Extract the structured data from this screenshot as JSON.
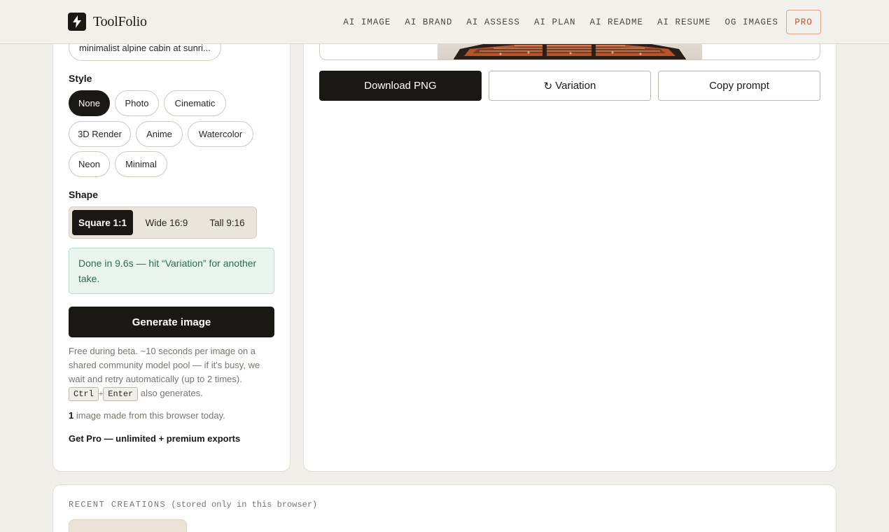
{
  "brand": {
    "name": "ToolFolio",
    "logo_icon": "lightning-bolt-icon"
  },
  "nav": {
    "links": [
      "AI IMAGE",
      "AI BRAND",
      "AI ASSESS",
      "AI PLAN",
      "AI README",
      "AI RESUME",
      "OG IMAGES"
    ],
    "pro_label": "PRO"
  },
  "prompt": {
    "chip_text": "minimalist alpine cabin at sunri..."
  },
  "style": {
    "label": "Style",
    "options": [
      "None",
      "Photo",
      "Cinematic",
      "3D Render",
      "Anime",
      "Watercolor",
      "Neon",
      "Minimal"
    ],
    "selected": "None"
  },
  "shape": {
    "label": "Shape",
    "options": [
      "Square 1:1",
      "Wide 16:9",
      "Tall 9:16"
    ],
    "selected": "Square 1:1"
  },
  "status": {
    "message": "Done in 9.6s — hit “Variation” for another take."
  },
  "generate": {
    "label": "Generate image"
  },
  "help": {
    "text": "Free during beta. ~10 seconds per image on a shared community model pool — if it's busy, we wait and retry automatically (up to 2 times).",
    "key1": "Ctrl",
    "plus": "+",
    "key2": "Enter",
    "suffix": "also generates."
  },
  "usage": {
    "count": "1",
    "text": "image made from this browser today."
  },
  "pro_link": "Get Pro — unlimited + premium exports",
  "actions": {
    "download_label": "Download PNG",
    "variation_icon": "refresh-icon",
    "variation_glyph": "↻",
    "variation_label": "Variation",
    "copy_label": "Copy prompt"
  },
  "recent": {
    "title": "RECENT CREATIONS",
    "note": "(stored only in this browser)"
  },
  "colors": {
    "accent": "#d9482b",
    "dark": "#1a1815",
    "success_text": "#2f6b4f",
    "success_bg": "#eaf5f0"
  }
}
